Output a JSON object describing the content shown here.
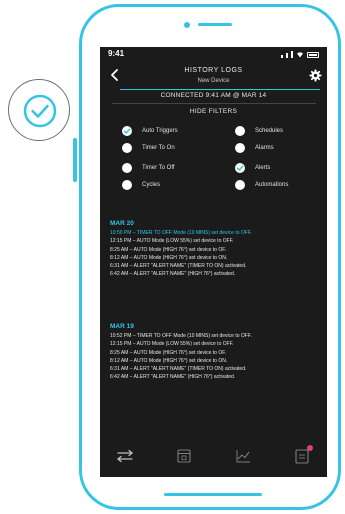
{
  "status_bar": {
    "time": "9:41"
  },
  "header": {
    "title": "HISTORY LOGS",
    "subtitle": "New Device",
    "connection": "CONNECTED  9:41 AM @ MAR 14"
  },
  "filters": {
    "heading": "HIDE FILTERS",
    "items": [
      {
        "label": "Auto Triggers",
        "checked": true
      },
      {
        "label": "Schedules",
        "checked": false
      },
      {
        "label": "Timer To On",
        "checked": false
      },
      {
        "label": "Alarms",
        "checked": false
      },
      {
        "label": "Timer To Off",
        "checked": false
      },
      {
        "label": "Alerts",
        "checked": true
      },
      {
        "label": "Cycles",
        "checked": false
      },
      {
        "label": "Automations",
        "checked": false
      }
    ]
  },
  "logs": [
    {
      "date": "MAR 20",
      "entries": [
        "10:50 PM – TIMER TO OFF Mode (10 MINS) set device  to OFF.",
        "12:15 PM – AUTO Mode (LOW 55%) set device to OFF.",
        "8:25 AM – AUTO Mode (HIGH 76°) set device to OF.",
        "8:12 AM – AUTO Mode (HIGH 76°) set device to ON.",
        "6:31 AM – ALERT \"ALERT NAME\" (TIMER TO ON) activated.",
        "6:42 AM – ALERT \"ALERT NAME\" (HIGH 76°) activated."
      ]
    },
    {
      "date": "MAR 19",
      "entries": [
        "10:52 PM – TIMER TO OFF Mode (10 MINS) set device  to OFF.",
        "12:15 PM – AUTO Mode (LOW 55%) set device to OFF.",
        "8:25 AM – AUTO Mode (HIGH 76°) set device to OF.",
        "8:12 AM – AUTO Mode (HIGH 76°) set device to ON.",
        "6:31 AM – ALERT \"ALERT NAME\" (TIMER TO ON) activated.",
        "6:42 AM – ALERT \"ALERT NAME\" (HIGH 76°) activated."
      ]
    }
  ],
  "tabs": [
    {
      "icon": "controls-icon"
    },
    {
      "icon": "calendar-icon"
    },
    {
      "icon": "chart-icon"
    },
    {
      "icon": "logs-icon",
      "active": true
    }
  ],
  "colors": {
    "accent": "#35c4e6",
    "screen_background": "#1b1b1c",
    "notification": "#e0407a"
  }
}
